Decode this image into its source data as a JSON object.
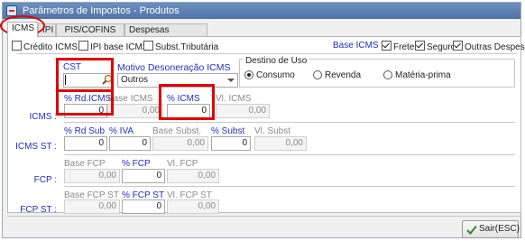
{
  "window": {
    "title": "Parâmetros de Impostos - Produtos"
  },
  "tabs": [
    {
      "label": "ICMS",
      "active": true
    },
    {
      "label": "IPI",
      "active": false
    },
    {
      "label": "PIS/COFINS",
      "active": false
    },
    {
      "label": "Despesas Acessórias",
      "active": false
    }
  ],
  "options": {
    "credito_icms": {
      "label": "Crédito ICMS",
      "checked": false
    },
    "ipi_base_icms": {
      "label": "IPI base ICMS",
      "checked": false
    },
    "subst_tributaria": {
      "label": "Subst.Tributária",
      "checked": false
    }
  },
  "base_icms": {
    "label": "Base ICMS :",
    "frete": {
      "label": "Frete",
      "checked": true
    },
    "seguro": {
      "label": "Seguro",
      "checked": true
    },
    "outras_despesas": {
      "label": "Outras Despesas",
      "checked": true
    }
  },
  "cst": {
    "label": "CST",
    "value": ""
  },
  "motivo_desoneracao": {
    "label": "Motivo Desoneração ICMS",
    "value": "Outros"
  },
  "destino_uso": {
    "label": "Destino de Uso",
    "options": [
      {
        "label": "Consumo",
        "selected": true
      },
      {
        "label": "Revenda",
        "selected": false
      },
      {
        "label": "Matéria-prima",
        "selected": false
      }
    ]
  },
  "icms": {
    "row_label": "ICMS :",
    "pct_rd_icms": {
      "label": "% Rd.ICMS",
      "value": "0"
    },
    "base_icms": {
      "label": "Base ICMS",
      "value": "0,00"
    },
    "pct_icms": {
      "label": "% ICMS",
      "value": "0"
    },
    "vl_icms": {
      "label": "Vl. ICMS",
      "value": "0,00"
    }
  },
  "icms_st": {
    "row_label": "ICMS ST :",
    "pct_rd_sub": {
      "label": "% Rd Sub",
      "value": "0"
    },
    "pct_iva": {
      "label": "% IVA",
      "value": "0"
    },
    "base_subst": {
      "label": "Base Subst.",
      "value": "0,00"
    },
    "pct_subst": {
      "label": "% Subst",
      "value": "0"
    },
    "vl_subst": {
      "label": "Vl. Subst",
      "value": "0,00"
    }
  },
  "fcp": {
    "row_label": "FCP :",
    "base_fcp": {
      "label": "Base FCP",
      "value": "0,00"
    },
    "pct_fcp": {
      "label": "% FCP",
      "value": "0"
    },
    "vl_fcp": {
      "label": "Vl. FCP",
      "value": "0,00"
    }
  },
  "fcp_st": {
    "row_label": "FCP ST :",
    "base_fcp_st": {
      "label": "Base FCP ST",
      "value": "0,00"
    },
    "pct_fcp_st": {
      "label": "% FCP ST",
      "value": "0"
    },
    "vl_fcp_st": {
      "label": "Vl. FCP ST",
      "value": "0,00"
    }
  },
  "footer": {
    "exit_label": "Sair(ESC)"
  },
  "icons": {
    "app": "app-icon",
    "search": "search-icon",
    "exit": "checkmark-exit-icon",
    "dropdown": "chevron-down-icon"
  },
  "colors": {
    "accent_label": "#1d2fb8",
    "highlight": "#e00000",
    "titlebar": "#5a7db0"
  }
}
